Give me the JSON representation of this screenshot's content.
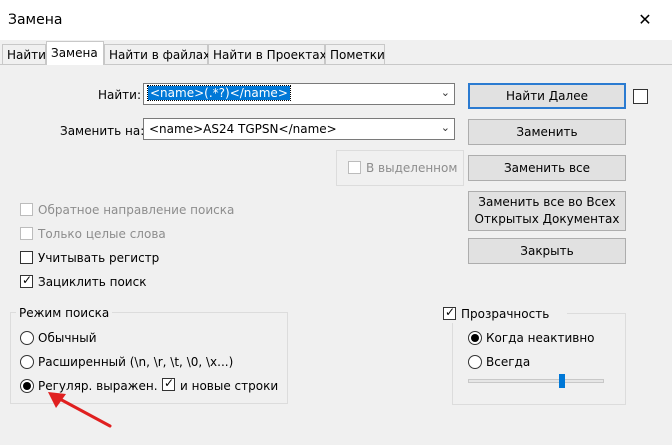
{
  "window": {
    "title": "Замена",
    "close_glyph": "✕"
  },
  "tabs": [
    {
      "label": "Найти",
      "active": false
    },
    {
      "label": "Замена",
      "active": true
    },
    {
      "label": "Найти в файлах",
      "active": false
    },
    {
      "label": "Найти в Проектах",
      "active": false
    },
    {
      "label": "Пометки",
      "active": false
    }
  ],
  "find": {
    "label": "Найти:",
    "value": "<name>(.*?)</name>"
  },
  "replace": {
    "label": "Заменить на:",
    "value": "<name>AS24 TGPSN</name>"
  },
  "in_selection": {
    "label": "В выделенном",
    "checked": false,
    "enabled": false
  },
  "buttons": {
    "find_next": "Найти Далее",
    "replace": "Заменить",
    "replace_all": "Заменить все",
    "replace_all_docs_line1": "Заменить все во Всех",
    "replace_all_docs_line2": "Открытых Документах",
    "close": "Закрыть"
  },
  "options": {
    "backward": {
      "label": "Обратное направление поиска",
      "checked": false,
      "enabled": false
    },
    "whole_word": {
      "label": "Только целые слова",
      "checked": false,
      "enabled": false
    },
    "match_case": {
      "label": "Учитывать регистр",
      "checked": false,
      "enabled": true
    },
    "wrap": {
      "label": "Зациклить поиск",
      "checked": true,
      "enabled": true
    }
  },
  "search_mode": {
    "title": "Режим поиска",
    "normal": "Обычный",
    "extended": "Расширенный (\\n, \\r, \\t, \\0, \\x...)",
    "regex": "Регуляр. выражен.",
    "selected": "regex",
    "newline_label": "и новые строки",
    "newline_checked": true
  },
  "transparency": {
    "label": "Прозрачность",
    "checked": true,
    "on_losing_focus": "Когда неактивно",
    "always": "Всегда",
    "selected": "on_losing_focus",
    "level": 0.7
  },
  "colors": {
    "accent": "#0078d7",
    "arrow": "#e02020"
  }
}
